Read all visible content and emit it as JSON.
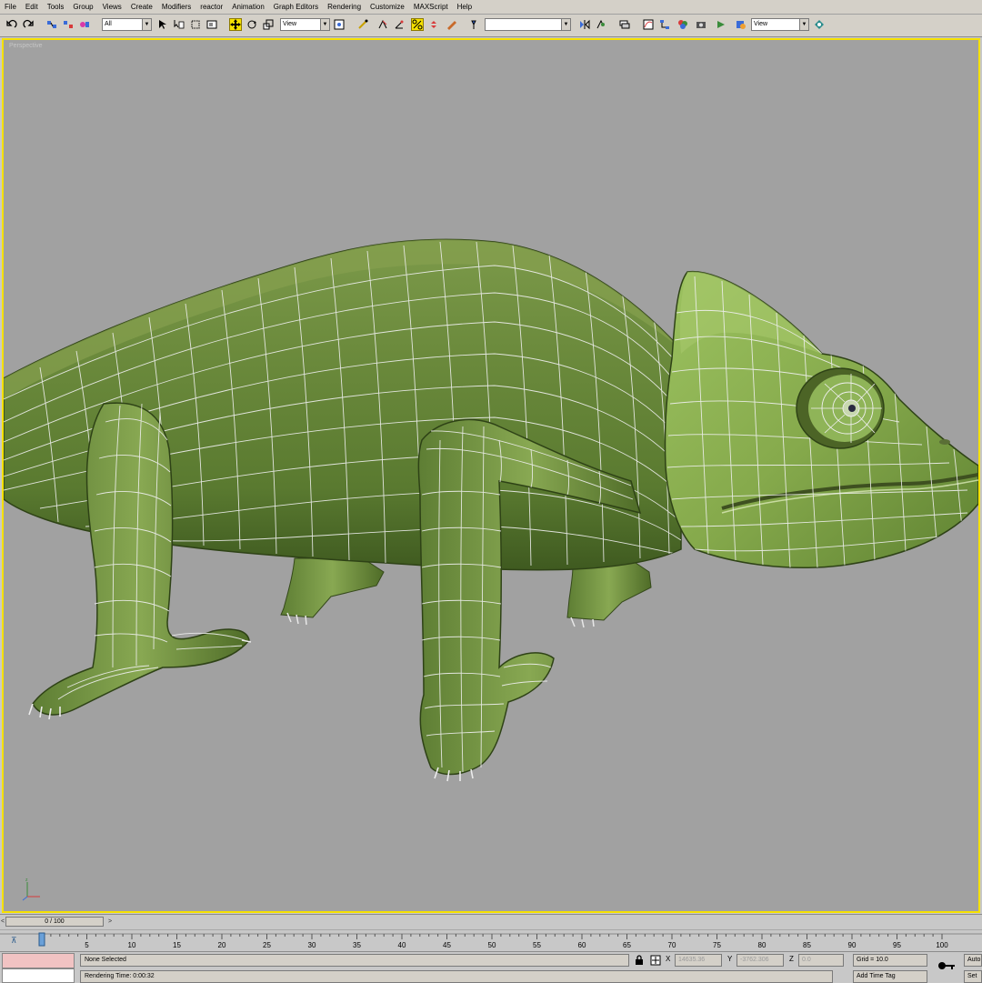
{
  "menu": [
    "File",
    "Edit",
    "Tools",
    "Group",
    "Views",
    "Create",
    "Modifiers",
    "reactor",
    "Animation",
    "Graph Editors",
    "Rendering",
    "Customize",
    "MAXScript",
    "Help"
  ],
  "toolbar": {
    "selection_filter": "All",
    "ref_coord_1": "View",
    "named_selection": "",
    "ref_coord_2": "View",
    "icons": [
      "undo-icon",
      "redo-icon",
      "select-link-icon",
      "unlink-icon",
      "bind-space-warp-icon",
      "select-object-icon",
      "select-by-name-icon",
      "rect-selection-icon",
      "window-crossing-icon",
      "select-move-icon",
      "select-rotate-icon",
      "select-scale-icon",
      "pivot-center-icon",
      "select-manipulate-icon",
      "snap-3d-icon",
      "angle-snap-icon",
      "percent-snap-icon",
      "spinner-snap-icon",
      "edit-named-sel-icon",
      "mirror-icon",
      "align-icon",
      "layer-manager-icon",
      "curve-editor-icon",
      "schematic-view-icon",
      "material-editor-icon",
      "render-scene-icon",
      "quick-render-icon"
    ]
  },
  "viewport": {
    "label": "Perspective",
    "border_color": "#f5e100",
    "background": "#a1a1a1",
    "model": "chameleon-mesh"
  },
  "time_slider": {
    "frame_label": "0 / 100",
    "current_frame": 0,
    "total_frames": 100
  },
  "trackbar": {
    "ticks": [
      5,
      10,
      15,
      20,
      25,
      30,
      35,
      40,
      45,
      50,
      55,
      60,
      65,
      70,
      75,
      80,
      85,
      90,
      95,
      100
    ],
    "extra_tick": "0"
  },
  "status": {
    "selection": "None Selected",
    "prompt": "Rendering Time: 0:00:32",
    "x_label": "X",
    "x_value": "14635.36",
    "y_label": "Y",
    "y_value": "-3762.306",
    "z_label": "Z",
    "z_value": "0.0",
    "grid": "Grid = 10.0",
    "add_time_tag": "Add Time Tag",
    "auto_key": "Auto",
    "set_key": "Set"
  }
}
